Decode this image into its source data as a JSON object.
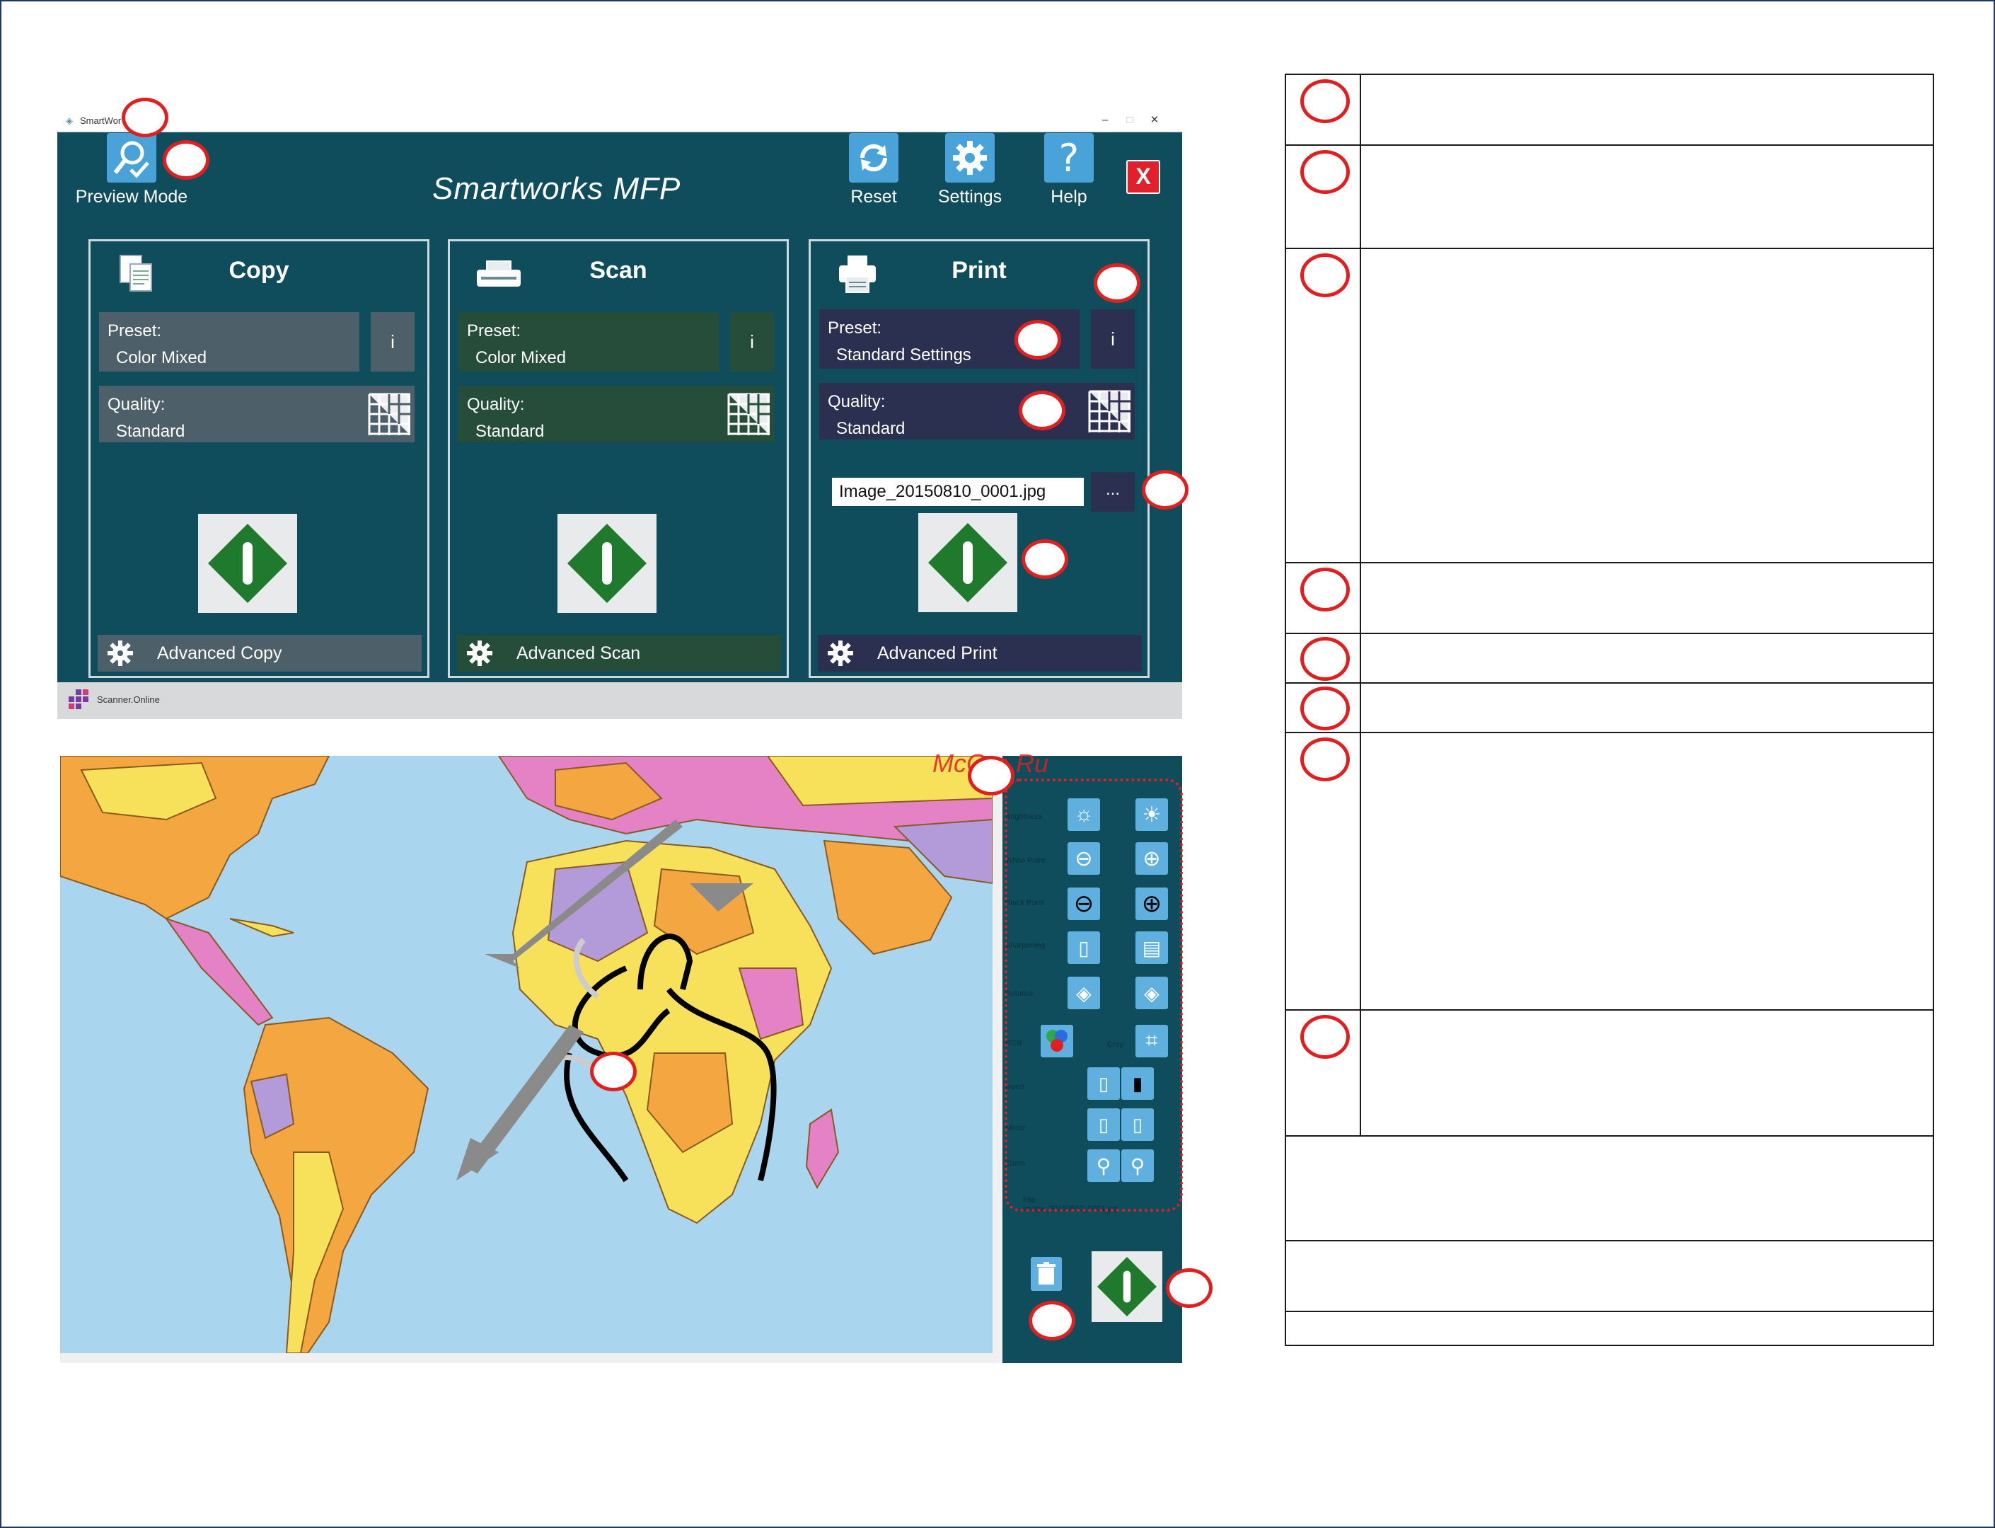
{
  "window": {
    "title": "SmartWor",
    "app_title": "Smartworks MFP",
    "preview_mode_label": "Preview Mode",
    "reset_label": "Reset",
    "settings_label": "Settings",
    "help_label": "Help",
    "close_label": "X",
    "status_text": "Scanner.Online"
  },
  "panels": {
    "copy": {
      "title": "Copy",
      "preset_label": "Preset:",
      "preset_value": "Color Mixed",
      "info_label": "i",
      "quality_label": "Quality:",
      "quality_value": "Standard",
      "advanced_label": "Advanced Copy",
      "color": "#4d5f69"
    },
    "scan": {
      "title": "Scan",
      "preset_label": "Preset:",
      "preset_value": "Color Mixed",
      "info_label": "i",
      "quality_label": "Quality:",
      "quality_value": "Standard",
      "advanced_label": "Advanced Scan",
      "color": "#254d3a"
    },
    "print": {
      "title": "Print",
      "preset_label": "Preset:",
      "preset_value": "Standard Settings",
      "info_label": "i",
      "quality_label": "Quality:",
      "quality_value": "Standard",
      "file_name": "Image_20150810_0001.jpg",
      "browse_label": "...",
      "advanced_label": "Advanced Print",
      "color": "#2c3050"
    }
  },
  "preview": {
    "controls": [
      "Brightness",
      "White Point",
      "Black Point",
      "Sharpening",
      "Rotation",
      "RGB",
      "Crop",
      "Invert",
      "Mirror",
      "Zoom"
    ],
    "file_label": "File",
    "file_value": "Image_20150810_0001.jpg"
  },
  "watermark": "McGrp.Ru",
  "colors": {
    "app_bg": "#0f4c5c",
    "accent_blue": "#4aa3d8",
    "go_green": "#1f7a2e",
    "callout_red": "#e02020"
  }
}
